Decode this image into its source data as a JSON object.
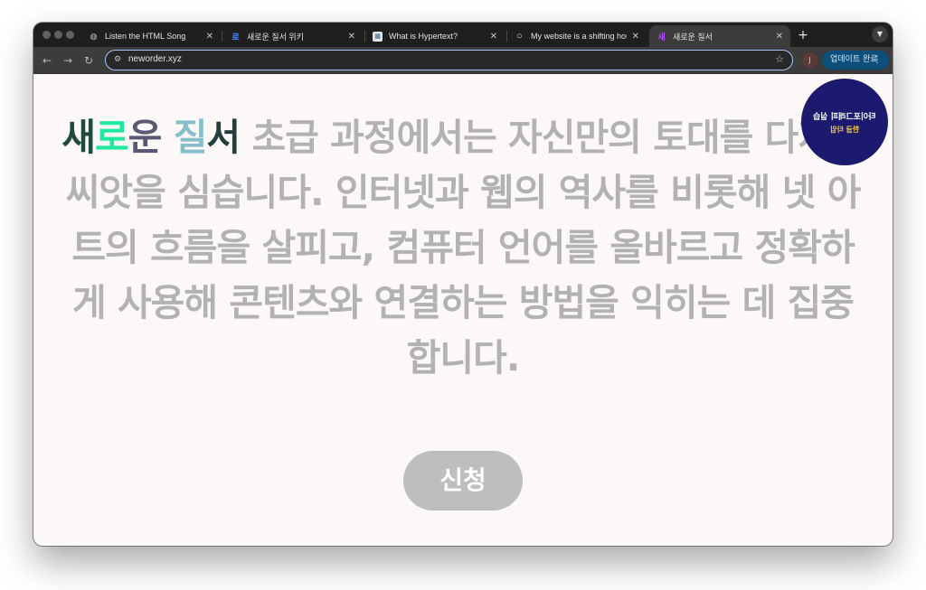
{
  "browser": {
    "tabs": [
      {
        "title": "Listen the HTML Song",
        "favicon": "globe-icon",
        "active": false
      },
      {
        "title": "새로운 질서 위키",
        "favicon": "wiki-icon",
        "active": false
      },
      {
        "title": "What is Hypertext?",
        "favicon": "page-icon",
        "active": false
      },
      {
        "title": "My website is a shifting house",
        "favicon": "circle-icon",
        "active": false
      },
      {
        "title": "새로운 질서",
        "favicon": "app-icon",
        "active": true
      }
    ],
    "new_tab": "+",
    "close_glyph": "✕",
    "url": "neworder.xyz",
    "profile_initial": "J",
    "update_label": "업데이트 완료",
    "menu_glyph": "⋮"
  },
  "page": {
    "title_words": [
      "새",
      "로",
      "운",
      "질",
      "서"
    ],
    "headline_rest": "초급 과정에서는 자신만의 토대를 다지고 씨앗을 심습니다. 인터넷과 웹의 역사를 비롯해 넷 아트의 흐름을 살피고, 컴퓨터 언어를 올바르고 정확하게 사용해 콘텐츠와 연결하는 방법을 익히는 데 집중합니다.",
    "apply_label": "신청",
    "badge_line1": "타이포그래피 실습",
    "badge_line2": "한글 타입"
  },
  "colors": {
    "title_sae": "#1d4d3a",
    "title_ro": "#1de9a0",
    "title_un": "#5b5875",
    "title_jil": "#86bfcc",
    "title_seo": "#243f3b",
    "body_text": "#b2b2b2",
    "button": "#bebebe"
  }
}
